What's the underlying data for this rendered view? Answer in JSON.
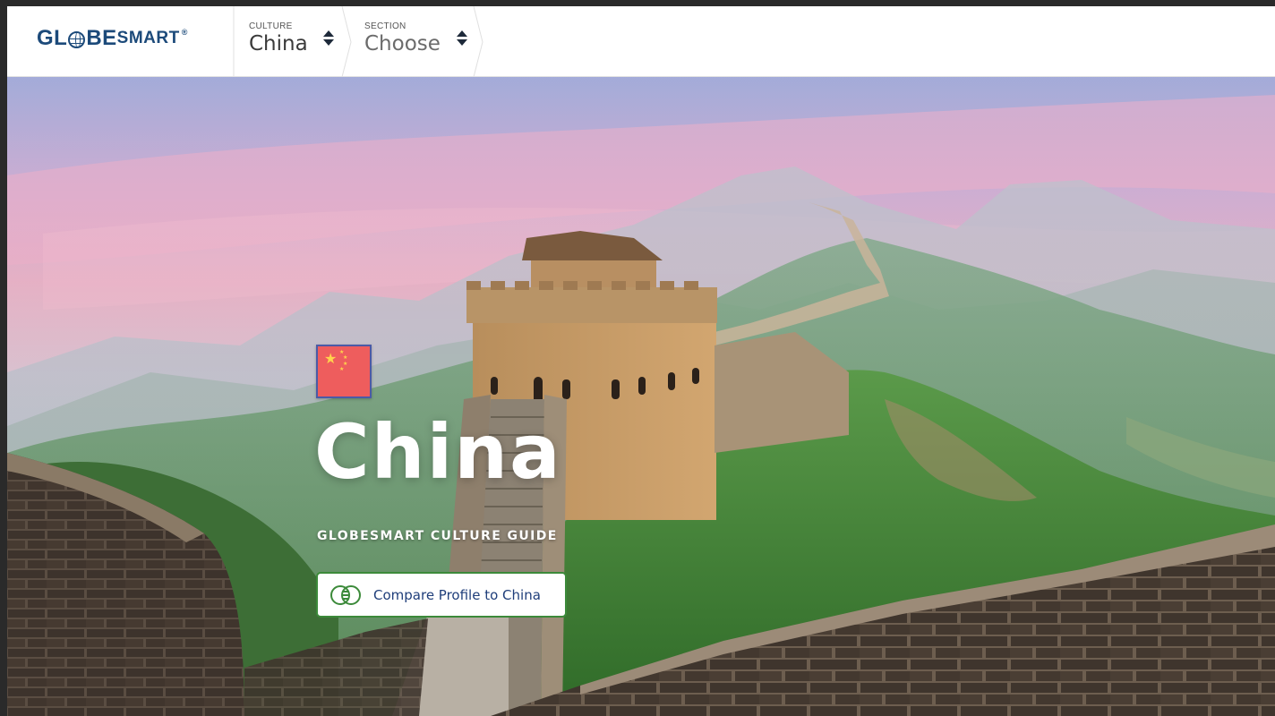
{
  "header": {
    "logo": {
      "part1": "GL",
      "part2": "BE",
      "part3": "SMART",
      "registered": "®"
    },
    "culture_picker": {
      "label": "CULTURE",
      "value": "China"
    },
    "section_picker": {
      "label": "SECTION",
      "value": "Choose"
    }
  },
  "hero": {
    "flag_icon": "china-flag-icon",
    "title": "China",
    "subtitle": "GLOBESMART CULTURE GUIDE",
    "compare_button": {
      "icon": "venn-compare-icon",
      "label": "Compare Profile to China"
    }
  },
  "colors": {
    "brand_blue": "#1c4a7a",
    "button_border_green": "#3c8a3a",
    "button_text_blue": "#1f3e7a",
    "flag_red": "#ee5d5d",
    "flag_star": "#ffd34d"
  }
}
